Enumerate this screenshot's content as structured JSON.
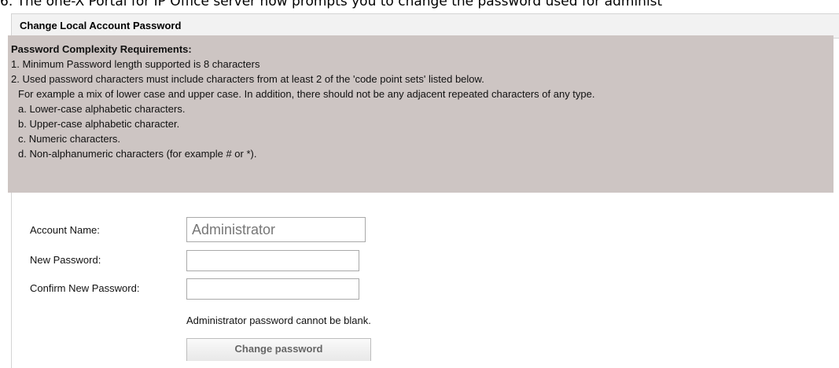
{
  "caption": "6. The one-X Portal for IP Office server now prompts you to change the password used for administ",
  "panel": {
    "title": "Change Local Account Password"
  },
  "requirements": {
    "title": "Password Complexity Requirements:",
    "lines": [
      "1. Minimum Password length supported is 8 characters",
      "2. Used password characters must include characters from at least 2 of the 'code point sets' listed below.",
      "For example a mix of lower case and upper case. In addition, there should not be any adjacent repeated characters of any type.",
      "a. Lower-case alphabetic characters.",
      "b. Upper-case alphabetic character.",
      "c. Numeric characters.",
      "d. Non-alphanumeric characters (for example # or *)."
    ]
  },
  "form": {
    "account_name_label": "Account Name:",
    "account_name_value": "Administrator",
    "new_password_label": "New Password:",
    "new_password_value": "",
    "confirm_password_label": "Confirm New Password:",
    "confirm_password_value": "",
    "error_message": "Administrator password cannot be blank.",
    "submit_label": "Change password"
  }
}
